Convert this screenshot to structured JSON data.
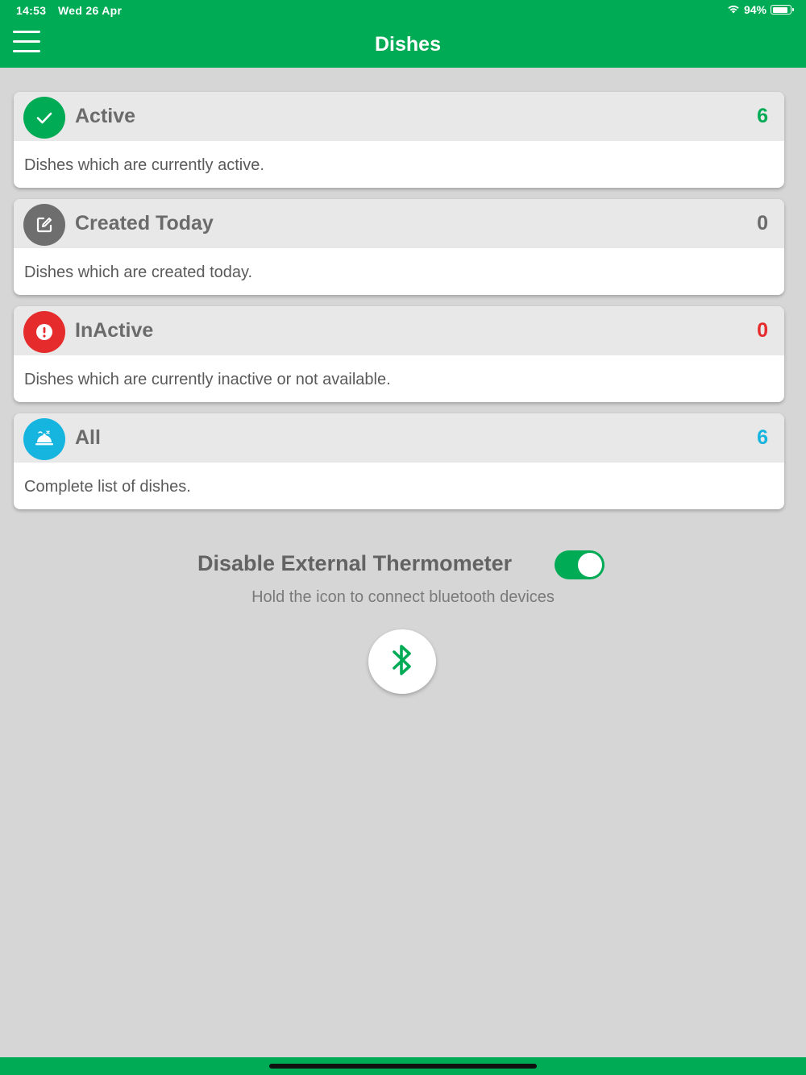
{
  "status_bar": {
    "time": "14:53",
    "date": "Wed 26 Apr",
    "battery": "94%",
    "battery_level": 0.94
  },
  "header": {
    "title": "Dishes"
  },
  "cards": [
    {
      "title": "Active",
      "count": "6",
      "description": "Dishes which are currently active.",
      "icon": "check-icon",
      "icon_color": "#00ab55",
      "count_color": "#00ab55"
    },
    {
      "title": "Created Today",
      "count": "0",
      "description": "Dishes which are created today.",
      "icon": "edit-icon",
      "icon_color": "#6e6e6e",
      "count_color": "#6b6b6b"
    },
    {
      "title": "InActive",
      "count": "0",
      "description": "Dishes which are currently inactive or not available.",
      "icon": "alert-icon",
      "icon_color": "#e52b2b",
      "count_color": "#e52b2b"
    },
    {
      "title": "All",
      "count": "6",
      "description": "Complete list of dishes.",
      "icon": "dish-icon",
      "icon_color": "#15b5e0",
      "count_color": "#15b5e0"
    }
  ],
  "thermometer": {
    "label": "Disable External Thermometer",
    "enabled": true,
    "hint": "Hold the icon to connect bluetooth devices"
  },
  "colors": {
    "accent": "#00ab55",
    "background": "#d6d6d6"
  }
}
